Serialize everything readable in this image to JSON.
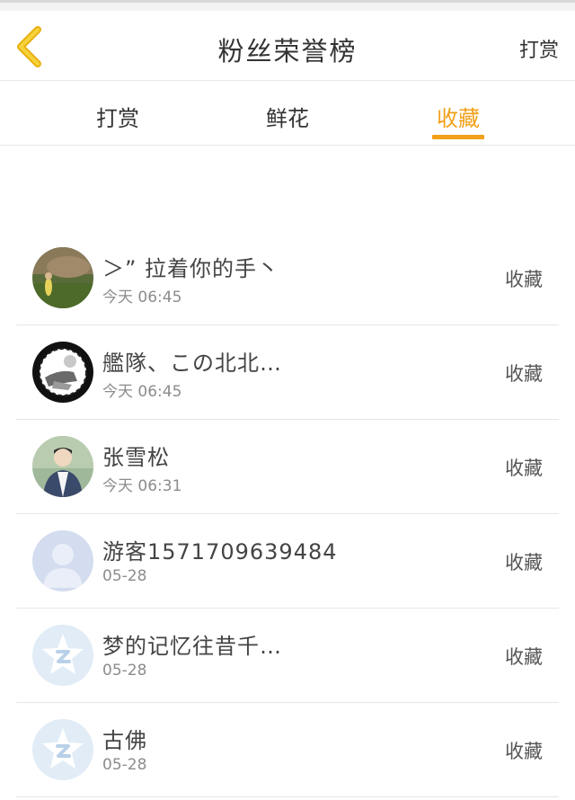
{
  "header": {
    "back_icon": "chevron-left-icon",
    "title": "粉丝荣誉榜",
    "action": "打赏"
  },
  "accent_color": "#f2a019",
  "tabs": [
    {
      "label": "打赏",
      "active": false
    },
    {
      "label": "鲜花",
      "active": false
    },
    {
      "label": "收藏",
      "active": true
    }
  ],
  "fans": [
    {
      "name": "＞” 拉着你的手丶",
      "time": "今天 06:45",
      "action": "收藏",
      "avatar": "photo-avatar"
    },
    {
      "name": "艦隊、この北北…",
      "time": "今天 06:45",
      "action": "收藏",
      "avatar": "photo-avatar"
    },
    {
      "name": "张雪松",
      "time": "今天 06:31",
      "action": "收藏",
      "avatar": "photo-avatar"
    },
    {
      "name": "游客1571709639484",
      "time": "05-28",
      "action": "收藏",
      "avatar": "default-user-icon"
    },
    {
      "name": "梦的记忆往昔千…",
      "time": "05-28",
      "action": "收藏",
      "avatar": "qq-star-icon"
    },
    {
      "name": "古佛",
      "time": "05-28",
      "action": "收藏",
      "avatar": "qq-star-icon"
    }
  ]
}
